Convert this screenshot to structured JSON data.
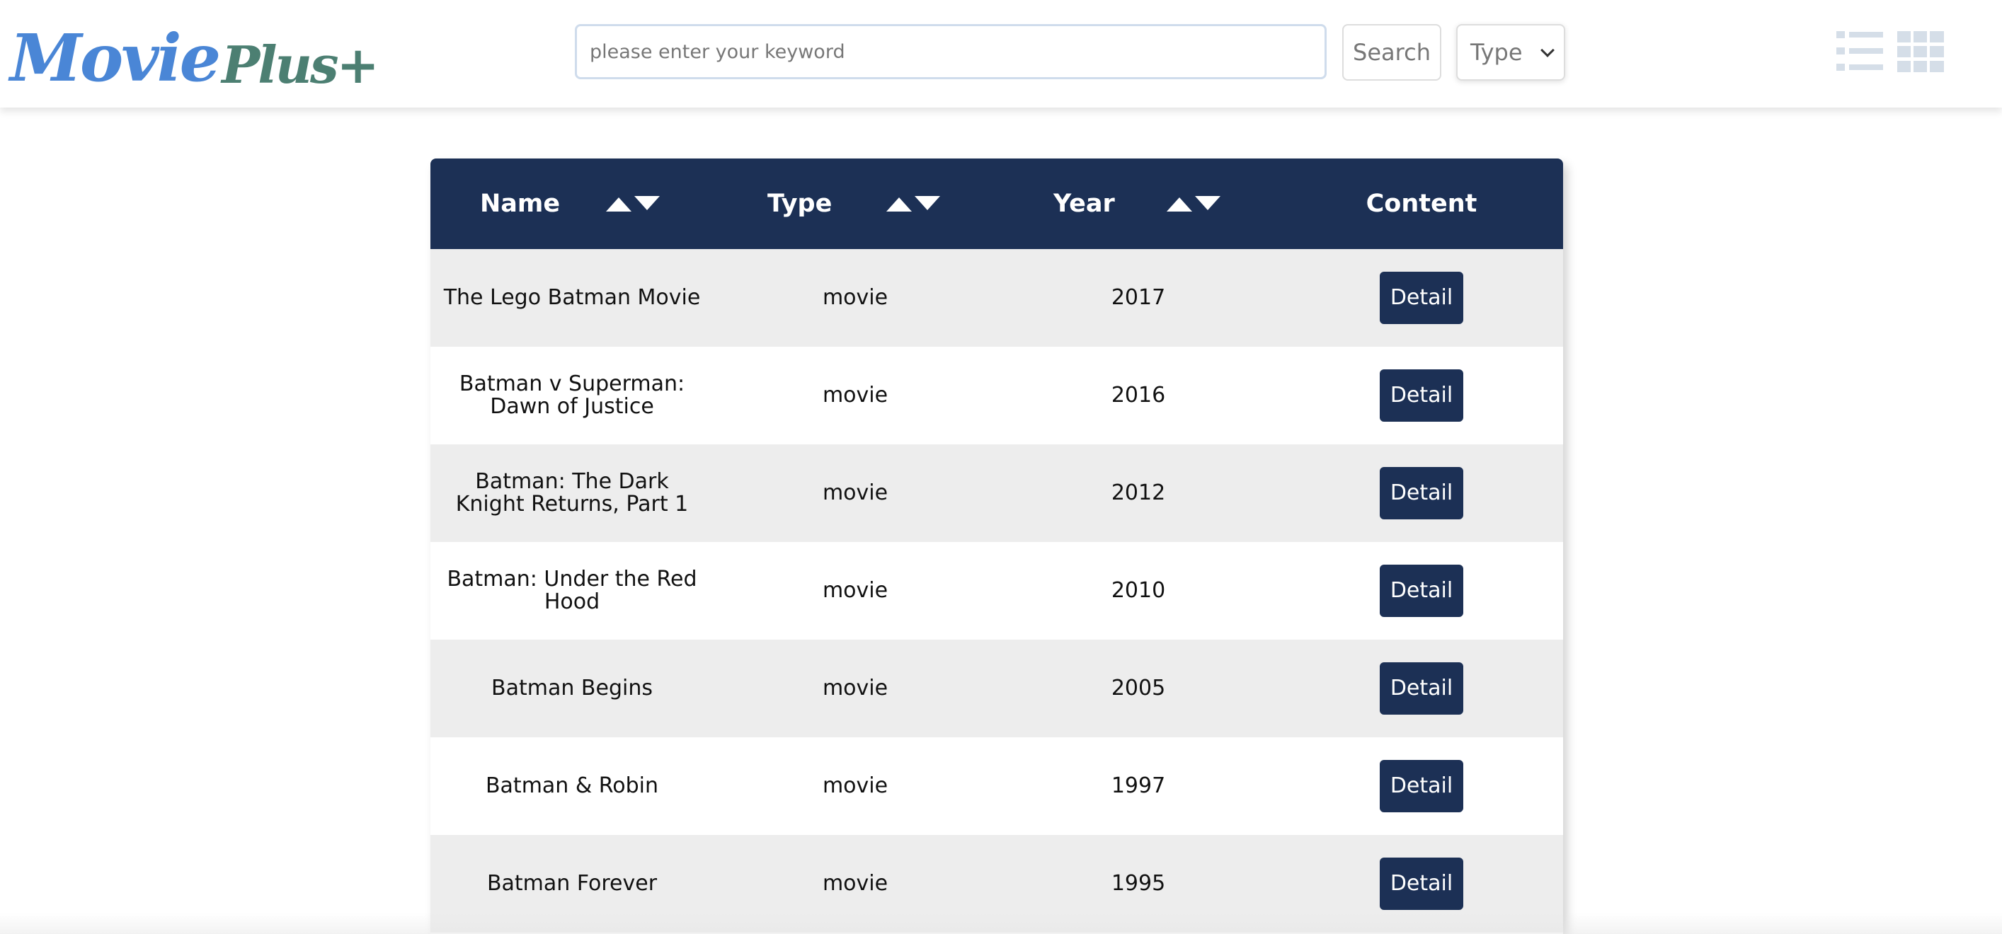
{
  "logo": {
    "part1": "Movie",
    "part2": "Plus+"
  },
  "search": {
    "placeholder": "please enter your keyword",
    "value": "",
    "button_label": "Search"
  },
  "type_filter": {
    "selected": "Type"
  },
  "view_toggle": {
    "list_icon": "list-view-icon",
    "grid_icon": "grid-view-icon",
    "color": "#d5dee8"
  },
  "table": {
    "headers": {
      "name": "Name",
      "type": "Type",
      "year": "Year",
      "content": "Content"
    },
    "rows": [
      {
        "name": "The Lego Batman Movie",
        "type": "movie",
        "year": "2017",
        "action": "Detail"
      },
      {
        "name": "Batman v Superman: Dawn of Justice",
        "type": "movie",
        "year": "2016",
        "action": "Detail"
      },
      {
        "name": "Batman: The Dark Knight Returns, Part 1",
        "type": "movie",
        "year": "2012",
        "action": "Detail"
      },
      {
        "name": "Batman: Under the Red Hood",
        "type": "movie",
        "year": "2010",
        "action": "Detail"
      },
      {
        "name": "Batman Begins",
        "type": "movie",
        "year": "2005",
        "action": "Detail"
      },
      {
        "name": "Batman & Robin",
        "type": "movie",
        "year": "1997",
        "action": "Detail"
      },
      {
        "name": "Batman Forever",
        "type": "movie",
        "year": "1995",
        "action": "Detail"
      }
    ]
  },
  "colors": {
    "header_bg": "#1c3055",
    "accent_blue": "#4a86d6",
    "accent_green": "#4c7f72",
    "row_alt": "#ededed"
  }
}
